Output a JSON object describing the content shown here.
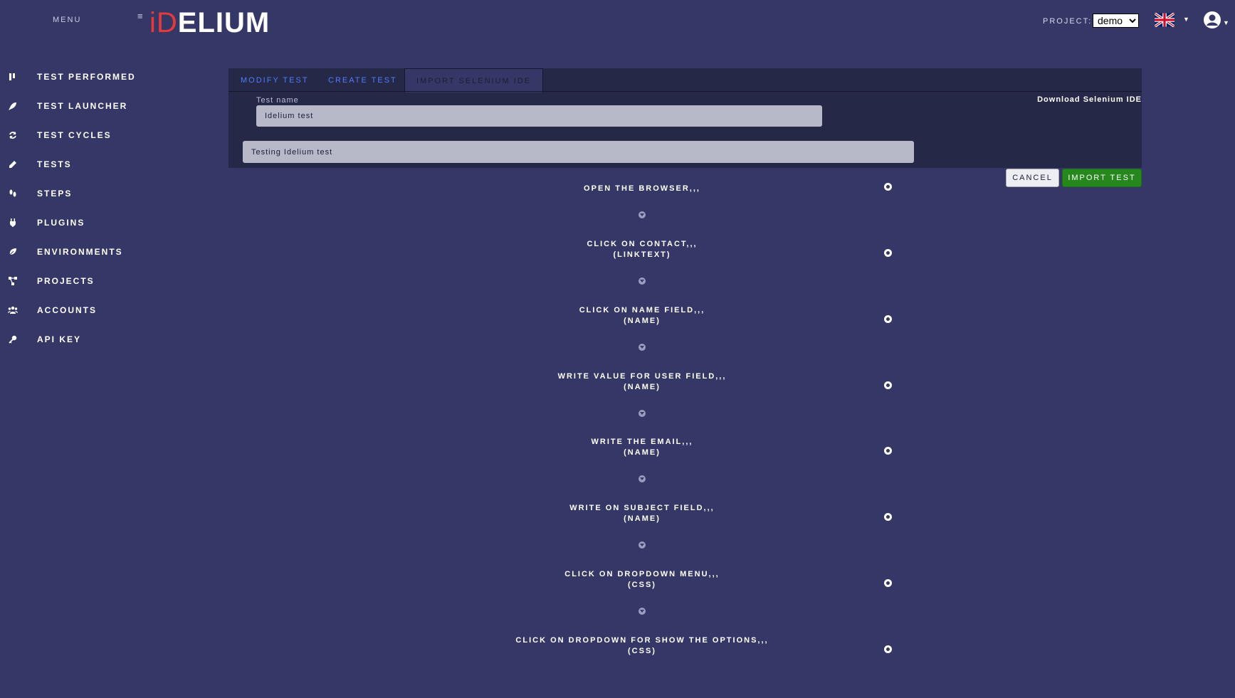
{
  "header": {
    "menu_label": "MENU",
    "hamburger_glyph": "≡",
    "logo_prefix": "iD",
    "logo_suffix": "ELIUM",
    "project_label": "PROJECT:",
    "project_value": "demo",
    "language_flag": "uk-flag-icon",
    "user_icon": "user-circle-icon"
  },
  "sidebar": {
    "items": [
      {
        "label": "TEST PERFORMED",
        "icon": "chart-icon"
      },
      {
        "label": "TEST LAUNCHER",
        "icon": "rocket-icon"
      },
      {
        "label": "TEST CYCLES",
        "icon": "refresh-icon"
      },
      {
        "label": "TESTS",
        "icon": "pencil-icon"
      },
      {
        "label": "STEPS",
        "icon": "footsteps-icon"
      },
      {
        "label": "PLUGINS",
        "icon": "plug-icon"
      },
      {
        "label": "ENVIRONMENTS",
        "icon": "leaf-icon"
      },
      {
        "label": "PROJECTS",
        "icon": "network-icon"
      },
      {
        "label": "ACCOUNTS",
        "icon": "users-icon"
      },
      {
        "label": "API KEY",
        "icon": "key-icon"
      }
    ]
  },
  "tabs": [
    {
      "label": "MODIFY TEST"
    },
    {
      "label": "CREATE TEST"
    },
    {
      "label": "IMPORT SELENIUM IDE"
    }
  ],
  "form": {
    "test_name_label": "Test name",
    "test_name_value": "Idelium test",
    "description_value": "Testing Idelium test",
    "download_link": "Download Selenium IDE"
  },
  "buttons": {
    "cancel": "CANCEL",
    "import": "IMPORT TEST"
  },
  "steps": [
    {
      "line1": "OPEN THE BROWSER,,,",
      "line2": ""
    },
    {
      "line1": "CLICK ON CONTACT,,,",
      "line2": "(LINKTEXT)"
    },
    {
      "line1": "CLICK ON NAME FIELD,,,",
      "line2": "(NAME)"
    },
    {
      "line1": "WRITE VALUE FOR USER FIELD,,,",
      "line2": "(NAME)"
    },
    {
      "line1": "WRITE THE EMAIL,,,",
      "line2": "(NAME)"
    },
    {
      "line1": "WRITE ON SUBJECT FIELD,,,",
      "line2": "(NAME)"
    },
    {
      "line1": "CLICK ON DROPDOWN MENU,,,",
      "line2": "(CSS)"
    },
    {
      "line1": "CLICK ON DROPDOWN FOR SHOW THE OPTIONS,,,",
      "line2": "(CSS)"
    }
  ],
  "colors": {
    "background": "#353866",
    "panel": "#262848",
    "tab_link": "#4f7df7",
    "import_button": "#26871d",
    "logo_accent": "#e5393c"
  }
}
